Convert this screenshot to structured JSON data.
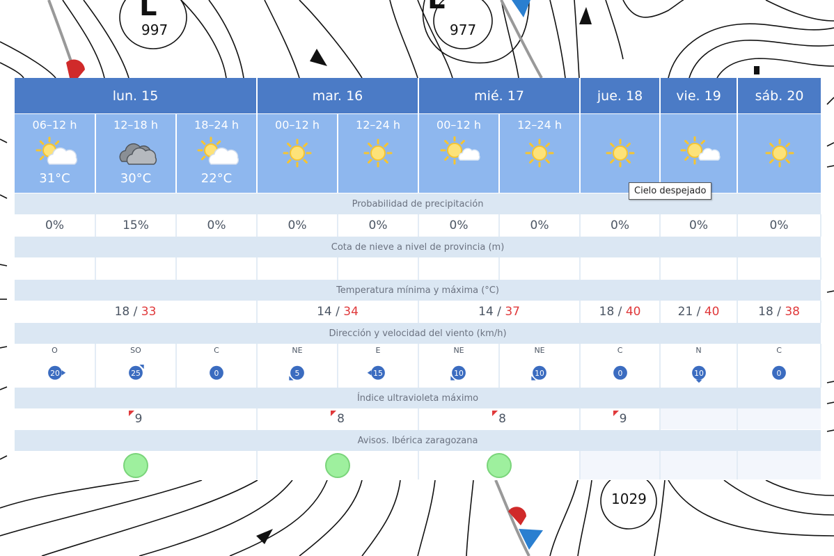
{
  "map": {
    "pressure_labels": [
      "997",
      "977",
      "1029"
    ],
    "low_letter": "L"
  },
  "days": [
    {
      "label": "lun. 15"
    },
    {
      "label": "mar. 16"
    },
    {
      "label": "mié. 17"
    },
    {
      "label": "jue. 18"
    },
    {
      "label": "vie. 19"
    },
    {
      "label": "sáb. 20"
    }
  ],
  "periods": [
    {
      "label": "06–12 h",
      "icon": "partly-cloudy-icon",
      "temp": "31°C"
    },
    {
      "label": "12–18 h",
      "icon": "cloudy-icon",
      "temp": "30°C"
    },
    {
      "label": "18–24 h",
      "icon": "partly-cloudy-icon",
      "temp": "22°C"
    },
    {
      "label": "00–12 h",
      "icon": "sun-icon",
      "temp": ""
    },
    {
      "label": "12–24 h",
      "icon": "sun-icon",
      "temp": ""
    },
    {
      "label": "00–12 h",
      "icon": "sun-small-cloud-icon",
      "temp": ""
    },
    {
      "label": "12–24 h",
      "icon": "sun-icon",
      "temp": ""
    },
    {
      "label": "",
      "icon": "sun-icon",
      "temp": ""
    },
    {
      "label": "",
      "icon": "sun-small-cloud-icon",
      "temp": ""
    },
    {
      "label": "",
      "icon": "sun-icon",
      "temp": ""
    }
  ],
  "sections": {
    "precip": "Probabilidad de precipitación",
    "snow": "Cota de nieve a nivel de provincia (m)",
    "temp": "Temperatura mínima y máxima (°C)",
    "wind": "Dirección y velocidad del viento (km/h)",
    "uv": "Índice ultravioleta máximo",
    "alerts": "Avisos. Ibérica zaragozana"
  },
  "precip": [
    "0%",
    "15%",
    "0%",
    "0%",
    "0%",
    "0%",
    "0%",
    "0%",
    "0%",
    "0%"
  ],
  "temps": [
    {
      "min": "18",
      "sep": " / ",
      "max": "33"
    },
    {
      "min": "14",
      "sep": " / ",
      "max": "34"
    },
    {
      "min": "14",
      "sep": " / ",
      "max": "37"
    },
    {
      "min": "18",
      "sep": " / ",
      "max": "40"
    },
    {
      "min": "21",
      "sep": " / ",
      "max": "40"
    },
    {
      "min": "18",
      "sep": " / ",
      "max": "38"
    }
  ],
  "wind": [
    {
      "dir": "O",
      "speed": "20",
      "arrow": "right"
    },
    {
      "dir": "SO",
      "speed": "25",
      "arrow": "top-right"
    },
    {
      "dir": "C",
      "speed": "0",
      "arrow": "none"
    },
    {
      "dir": "NE",
      "speed": "5",
      "arrow": "bottom-left"
    },
    {
      "dir": "E",
      "speed": "15",
      "arrow": "left"
    },
    {
      "dir": "NE",
      "speed": "10",
      "arrow": "bottom-left"
    },
    {
      "dir": "NE",
      "speed": "10",
      "arrow": "bottom-left"
    },
    {
      "dir": "C",
      "speed": "0",
      "arrow": "none"
    },
    {
      "dir": "N",
      "speed": "10",
      "arrow": "bottom"
    },
    {
      "dir": "C",
      "speed": "0",
      "arrow": "none"
    }
  ],
  "uv": [
    "9",
    "8",
    "8",
    "9"
  ],
  "tooltip": "Cielo despejado",
  "colors": {
    "header_blue": "#4b7bc6",
    "period_blue": "#8eb7ee",
    "max_temp_red": "#e0393b",
    "alert_green": "#9ef09e",
    "wind_badge": "#3b6cc0"
  }
}
